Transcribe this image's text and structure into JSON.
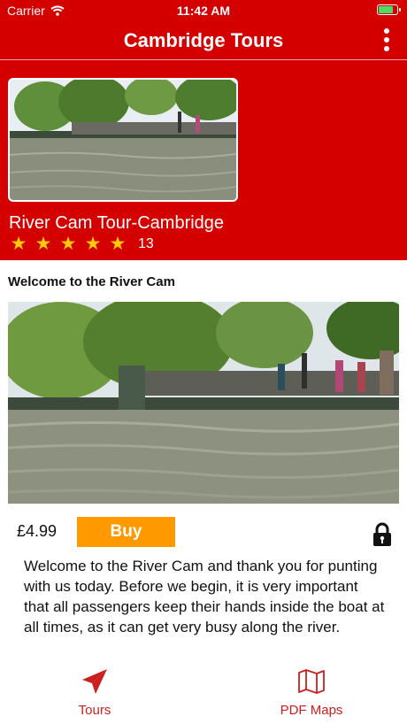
{
  "status_bar": {
    "carrier": "Carrier",
    "time": "11:42 AM"
  },
  "nav": {
    "title": "Cambridge Tours"
  },
  "tour": {
    "title": "River Cam Tour-Cambridge",
    "rating": 5,
    "review_count": "13"
  },
  "section": {
    "title": "Welcome to the River Cam"
  },
  "purchase": {
    "price": "£4.99",
    "buy_label": "Buy"
  },
  "description": "Welcome to the River Cam and thank you for punting with us today. Before we begin, it is very important that all passengers keep their hands inside the boat at all times, as it can get very busy along  the river.",
  "tabs": [
    {
      "label": "Tours",
      "icon": "paper-plane-icon"
    },
    {
      "label": "PDF Maps",
      "icon": "map-icon"
    }
  ],
  "colors": {
    "brand_red": "#d40000",
    "buy_orange": "#ff9900",
    "star_yellow": "#ffcc00"
  }
}
